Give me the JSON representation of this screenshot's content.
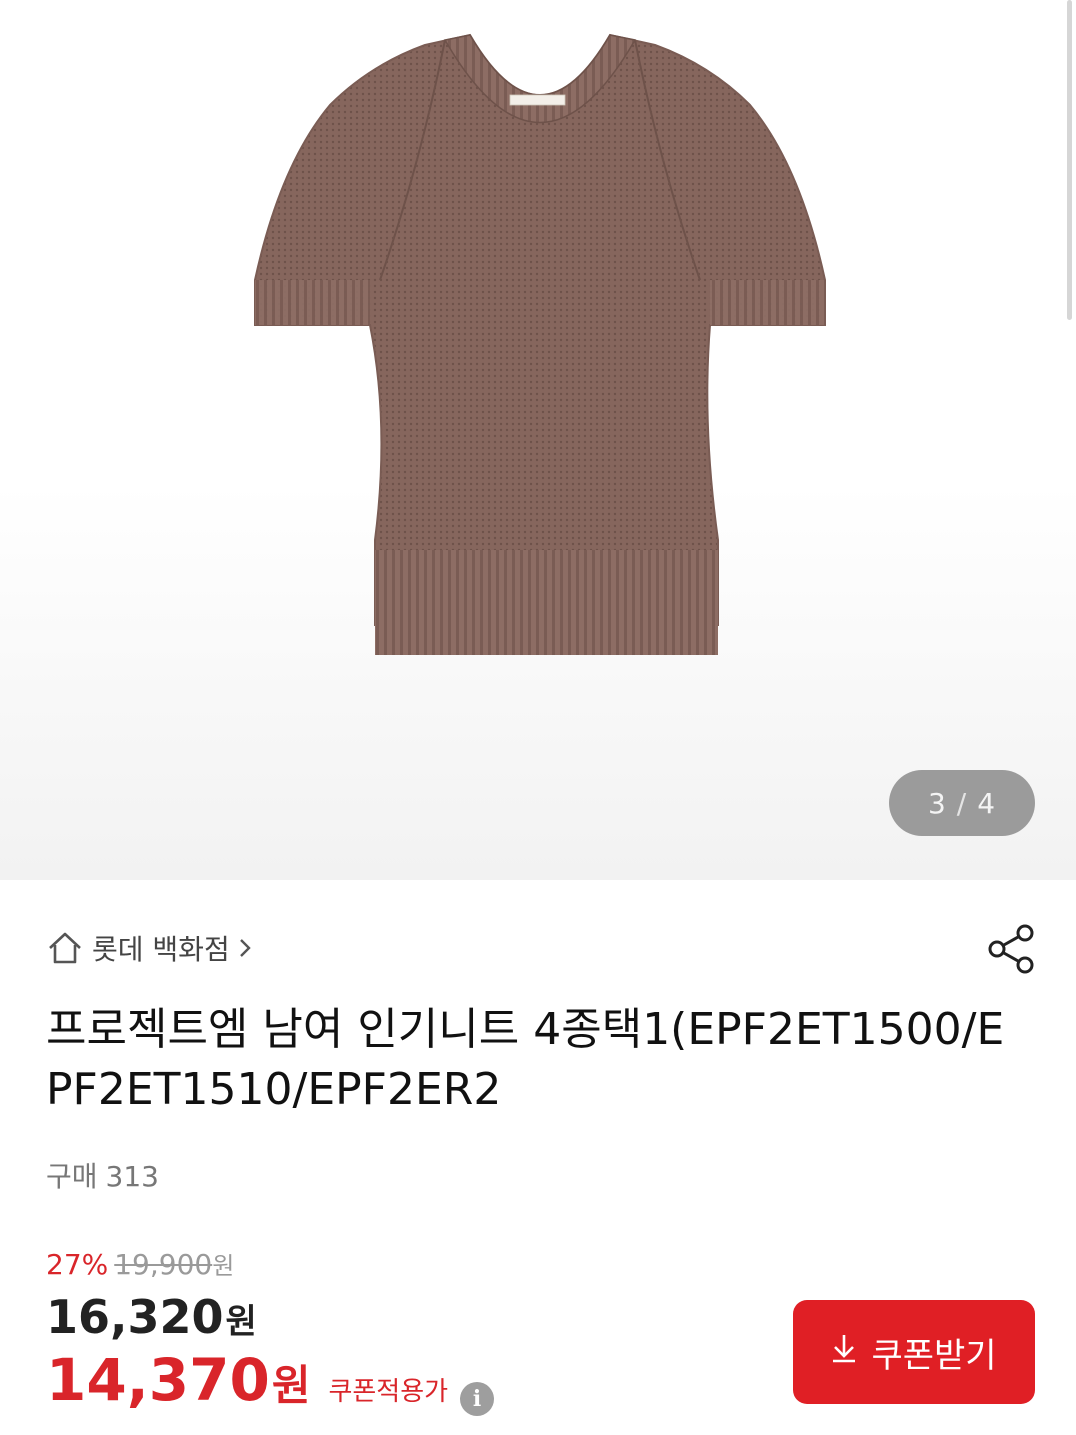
{
  "gallery": {
    "current_page": "3",
    "separator": "/",
    "total_pages": "4",
    "icon": "product-photo-knit-sweater"
  },
  "seller": {
    "store_name": "롯데 백화점",
    "home_icon": "home-icon",
    "chevron_icon": "chevron-right-icon"
  },
  "share_icon": "share-icon",
  "product": {
    "title": "프로젝트엠 남여 인기니트 4종택1(EPF2ET1500/EPF2ET1510/EPF2ER2",
    "purchase_label": "구매",
    "purchase_count": "313"
  },
  "price": {
    "discount_rate": "27%",
    "original_price": "19,900",
    "original_unit": "원",
    "sale_price": "16,320",
    "sale_unit": "원",
    "coupon_price": "14,370",
    "coupon_unit": "원",
    "coupon_label": "쿠폰적용가",
    "info_icon": "i"
  },
  "coupon_button": {
    "label": "쿠폰받기",
    "icon": "download-arrow-icon"
  },
  "colors": {
    "accent_red": "#e01f25",
    "text_dark": "#111111",
    "text_gray": "#777777",
    "indicator_bg": "#9b9b9b",
    "sweater": "#8a6a62"
  }
}
